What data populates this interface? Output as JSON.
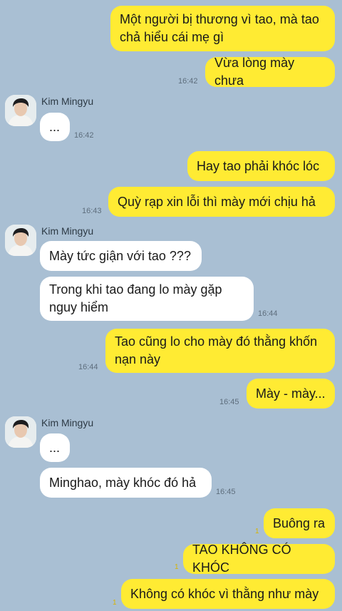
{
  "messages": [
    {
      "id": "m1",
      "side": "me",
      "text": "Một người bị thương vì tao, mà tao\nchả hiểu cái mẹ gì",
      "time": ""
    },
    {
      "id": "m2",
      "side": "me",
      "text": "Vừa lòng mày chưa",
      "time": "16:42"
    },
    {
      "id": "m3",
      "side": "them",
      "sender": "Kim Mingyu",
      "text": "...",
      "time": "16:42"
    },
    {
      "id": "m4",
      "side": "me",
      "text": "Hay tao phải khóc lóc",
      "time": ""
    },
    {
      "id": "m5",
      "side": "me",
      "text": "Quỳ rạp xin lỗi thì mày mới chịu hả",
      "time": "16:43"
    },
    {
      "id": "m6",
      "side": "them",
      "sender": "Kim Mingyu",
      "text": "Mày tức giận với tao ???",
      "time": ""
    },
    {
      "id": "m7",
      "side": "them",
      "text": "Trong khi tao đang lo mày gặp\nnguy hiểm",
      "time": "16:44"
    },
    {
      "id": "m8",
      "side": "me",
      "text": "Tao cũng lo cho mày đó thằng khốn\nnạn này",
      "time": "16:44"
    },
    {
      "id": "m9",
      "side": "me",
      "text": "Mày - mày...",
      "time": "16:45"
    },
    {
      "id": "m10",
      "side": "them",
      "sender": "Kim Mingyu",
      "text": "...",
      "time": ""
    },
    {
      "id": "m11",
      "side": "them",
      "text": "Minghao, mày khóc đó hả",
      "time": "16:45"
    },
    {
      "id": "m12",
      "side": "me",
      "text": "Buông ra",
      "time": "",
      "unread": "1"
    },
    {
      "id": "m13",
      "side": "me",
      "text": "TAO KHÔNG CÓ KHÓC",
      "time": "",
      "unread": "1"
    },
    {
      "id": "m14",
      "side": "me",
      "text": "Không có khóc vì thằng như mày",
      "time": "",
      "unread": "1"
    }
  ],
  "colors": {
    "background": "#a9bfd3",
    "my_bubble": "#ffeb33",
    "their_bubble": "#ffffff"
  }
}
